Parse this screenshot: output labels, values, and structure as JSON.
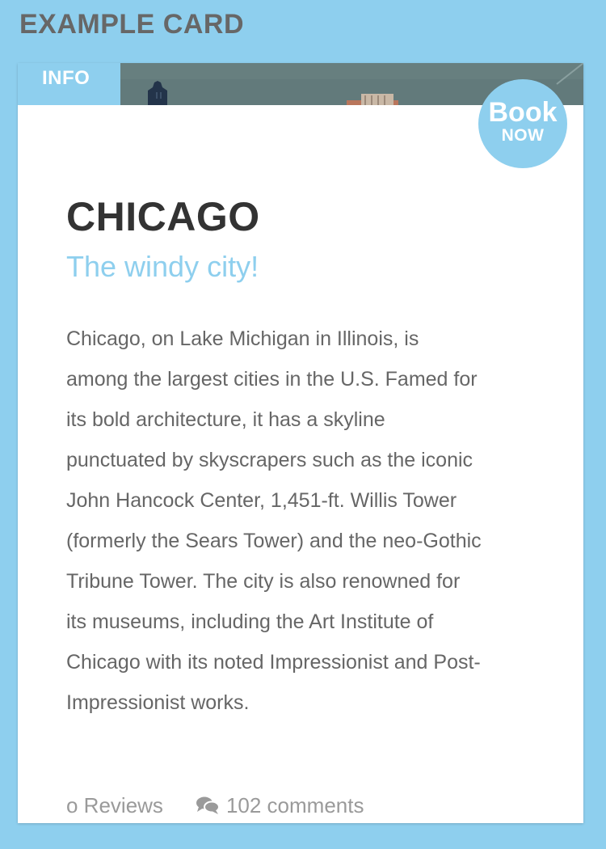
{
  "page": {
    "heading": "EXAMPLE CARD"
  },
  "card": {
    "info_tab": "INFO",
    "book": {
      "line1": "Book",
      "line2": "NOW"
    },
    "title": "CHICAGO",
    "subtitle": "The windy city!",
    "description": "Chicago, on Lake Michigan in Illinois, is\namong the largest cities in the U.S. Famed for\nits bold architecture, it has a skyline\npunctuated by skyscrapers such as the iconic\nJohn Hancock Center, 1,451-ft. Willis Tower\n(formerly the Sears Tower) and the neo-Gothic\nTribune Tower. The city is also renowned for\nits museums, including the Art Institute of\nChicago with its noted Impressionist and Post-\nImpressionist works.",
    "footer": {
      "reviews": "o Reviews",
      "comments": "102 comments",
      "comments_icon": "comments-icon"
    }
  },
  "colors": {
    "background": "#8ecfee",
    "accent": "#8ecfee",
    "title": "#333333",
    "body_text": "#666666",
    "meta_text": "#9a9a9a",
    "heading": "#676767"
  }
}
